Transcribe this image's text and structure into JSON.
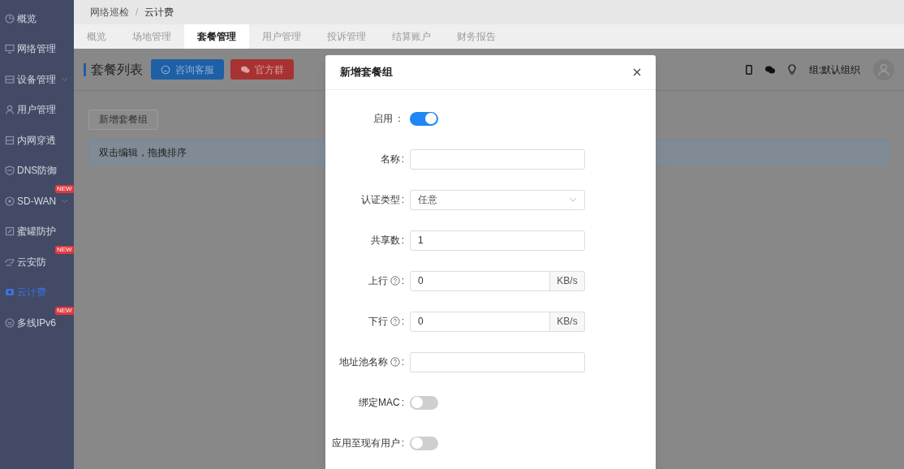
{
  "sidebar": {
    "items": [
      {
        "label": "概览",
        "selected": false
      },
      {
        "label": "网络管理",
        "selected": false
      },
      {
        "label": "设备管理",
        "selected": false,
        "expandable": true
      },
      {
        "label": "用户管理",
        "selected": false
      },
      {
        "label": "内网穿透",
        "selected": false
      },
      {
        "label": "DNS防御",
        "selected": false
      },
      {
        "label": "SD-WAN",
        "selected": false,
        "expandable": true,
        "badge": "NEW"
      },
      {
        "label": "蜜罐防护",
        "selected": false
      },
      {
        "label": "云安防",
        "selected": false,
        "badge": "NEW"
      },
      {
        "label": "云计费",
        "selected": true
      },
      {
        "label": "多线IPv6",
        "selected": false,
        "badge": "NEW"
      }
    ]
  },
  "breadcrumb": {
    "items": [
      "网络巡检",
      "云计费"
    ],
    "separator": "/"
  },
  "tabs": [
    {
      "label": "概览",
      "selected": false
    },
    {
      "label": "场地管理",
      "selected": false
    },
    {
      "label": "套餐管理",
      "selected": true
    },
    {
      "label": "用户管理",
      "selected": false
    },
    {
      "label": "投诉管理",
      "selected": false
    },
    {
      "label": "结算账户",
      "selected": false
    },
    {
      "label": "财务报告",
      "selected": false
    }
  ],
  "page_header": {
    "title": "套餐列表",
    "buttons": [
      {
        "label": "咨询客服",
        "kind": "consult"
      },
      {
        "label": "官方群",
        "kind": "group"
      }
    ],
    "group": "组:默认组织"
  },
  "toolbar": {
    "add_button": "新增套餐组"
  },
  "info_bar": {
    "text": "双击编辑，拖拽排序"
  },
  "dialog": {
    "title": "新增套餐组",
    "fields": [
      {
        "kind": "switch",
        "label": "启用",
        "colon": "：",
        "on": true
      },
      {
        "kind": "text",
        "label": "名称",
        "colon": ":"
      },
      {
        "kind": "select",
        "label": "认证类型",
        "colon": ":",
        "value": "任意"
      },
      {
        "kind": "text",
        "label": "共享数",
        "colon": ":",
        "value": "1"
      },
      {
        "kind": "unit",
        "label": "上行",
        "colon": ":",
        "help": true,
        "value": "0",
        "unit": "KB/s"
      },
      {
        "kind": "unit",
        "label": "下行",
        "colon": ":",
        "help": true,
        "value": "0",
        "unit": "KB/s"
      },
      {
        "kind": "text",
        "label": "地址池名称",
        "colon": ":",
        "help": true
      },
      {
        "kind": "switch",
        "label": "绑定MAC",
        "colon": ":",
        "on": false
      },
      {
        "kind": "switch",
        "label": "应用至现有用户",
        "colon": ":",
        "on": false
      }
    ]
  }
}
